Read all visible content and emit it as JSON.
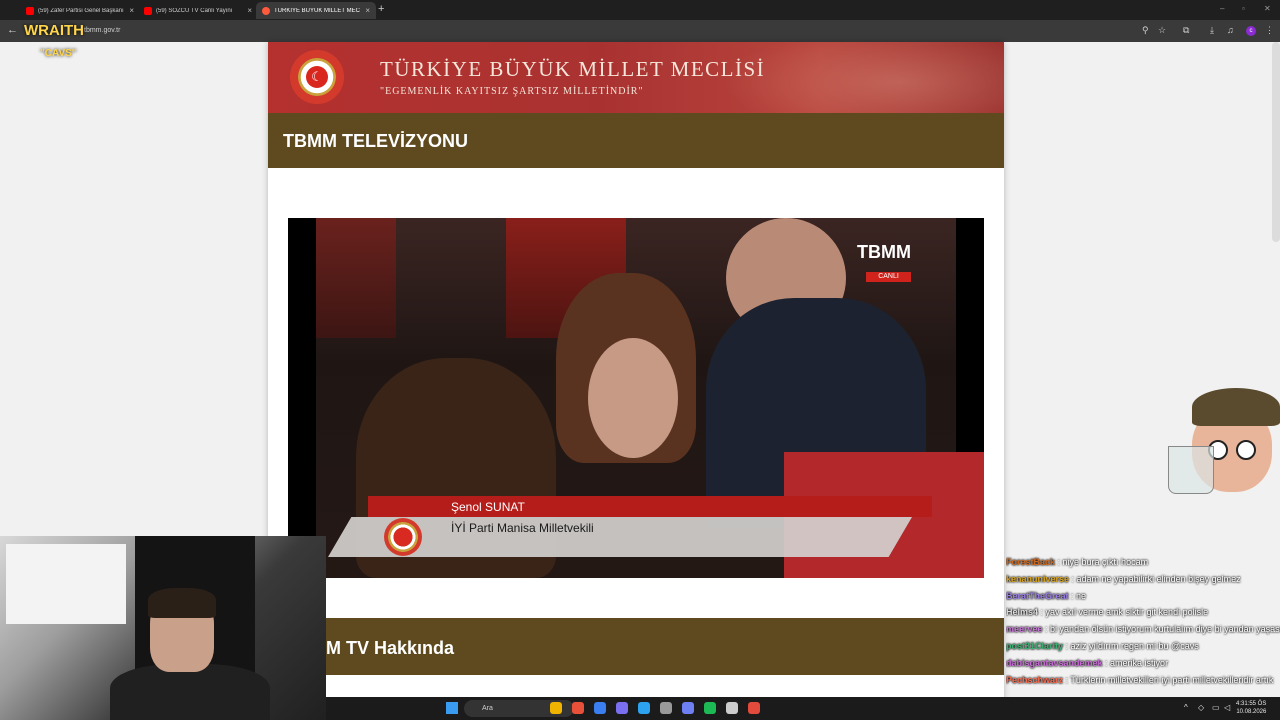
{
  "browser": {
    "tabs": [
      {
        "label": "(59) Zafer Partisi Genel Başkanı",
        "favicon_color": "#ff0000",
        "active": false
      },
      {
        "label": "(59) SÖZCÜ TV Canlı Yayını",
        "favicon_color": "#ff0000",
        "active": false
      },
      {
        "label": "TÜRKİYE BÜYÜK MİLLET MEC",
        "favicon_color": "#ff5a3c",
        "active": true
      }
    ],
    "close_glyph": "×",
    "new_tab_glyph": "+",
    "back_glyph": "←",
    "url": "tbmm.gov.tr",
    "profile_initial": "c"
  },
  "overlay": {
    "brand": "WRAITH",
    "brand_sub": "\"CAVS\""
  },
  "site": {
    "banner_title": "TÜRKİYE BÜYÜK MİLLET MECLİSİ",
    "banner_subtitle": "\"EGEMENLİK KAYITSIZ ŞARTSIZ MİLLETİNDİR\"",
    "section_title": "TBMM TELEVİZYONU",
    "player": {
      "channel_logo": "TBMM",
      "channel_badge": "CANLI",
      "speaker_name": "Şenol SUNAT",
      "speaker_role": "İYİ Parti Manisa Milletvekili"
    },
    "about_title": "M TV Hakkında"
  },
  "chat": [
    {
      "user": "ForestBack",
      "color": "#d2691e",
      "text": "niye bura çıktı hocam"
    },
    {
      "user": "kenanuniverse",
      "color": "#daa520",
      "text": "adam ne yapabilirki elinden bişey gelmez"
    },
    {
      "user": "BeratTheGreat",
      "color": "#9b7fe6",
      "text": "ne"
    },
    {
      "user": "Helms4",
      "color": "#dddddd",
      "text": "yav akıl verme amk siktir git kendi polisle"
    },
    {
      "user": "meervee",
      "color": "#c97bd8",
      "text": "bi yandan ölsün istiyorum kurtulalım diye bi yandan yaşasın da acı çeksin ölmesin istiyorum"
    },
    {
      "user": "post31Clarity",
      "color": "#3cb371",
      "text": "aziz yıldırım regen mi bu @cavs"
    },
    {
      "user": "dabisgantavsandemek",
      "color": "#c86bd6",
      "text": "amerika istiyor"
    },
    {
      "user": "Pechschwarz",
      "color": "#ff6a4d",
      "text": "Türklerin milletvekilleri iyi parti milletvekilleridir artık"
    }
  ],
  "taskbar": {
    "search_label": "Ara",
    "time": "4:31:55 ÖS",
    "date": "10.08.2026",
    "apps": [
      "#f0b400",
      "#e8503a",
      "#3a7ef0",
      "#7a6ff0",
      "#2da3f0",
      "#999999",
      "#6e7ff3",
      "#1db954",
      "#cccccc",
      "#e24a3b"
    ]
  }
}
